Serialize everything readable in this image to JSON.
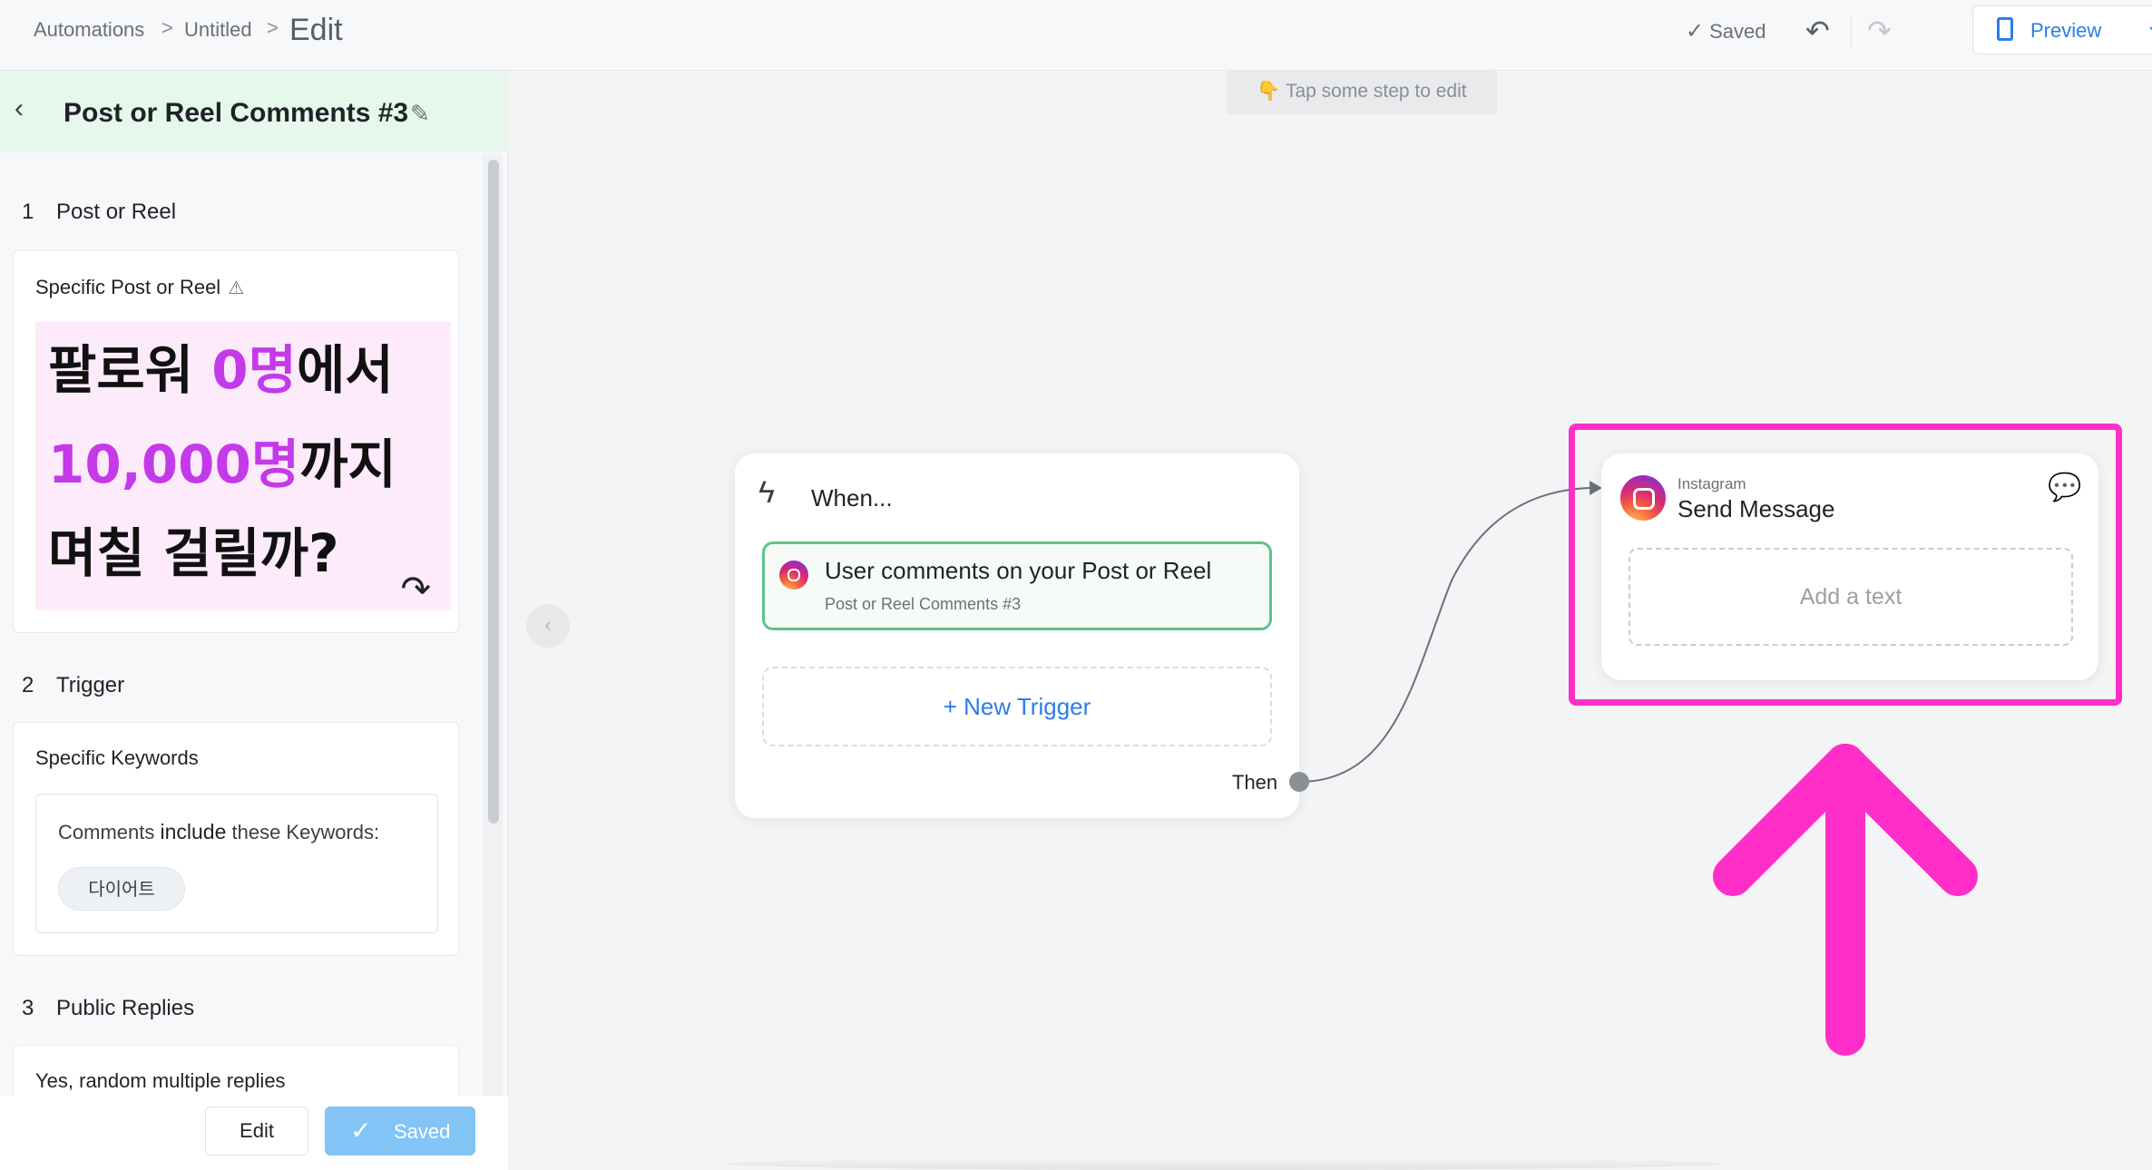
{
  "breadcrumb": {
    "root": "Automations",
    "middle": "Untitled",
    "current": "Edit",
    "sep": ">"
  },
  "topbar": {
    "saved": "Saved",
    "preview": "Preview",
    "check_glyph": "✓",
    "undo_glyph": "↶",
    "redo_glyph": "↷",
    "chevron_glyph": "⌄"
  },
  "panel": {
    "title": "Post or Reel Comments #3",
    "sections": [
      {
        "num": "1",
        "label": "Post or Reel"
      },
      {
        "num": "2",
        "label": "Trigger"
      },
      {
        "num": "3",
        "label": "Public Replies"
      }
    ],
    "post_card": {
      "title": "Specific Post or Reel",
      "thumbnail_lines": [
        {
          "a": "팔로워 ",
          "b": "0명",
          "c": "에서"
        },
        {
          "a": "",
          "b": "10,000명",
          "c": "까지"
        },
        {
          "a": "며칠 걸릴까?",
          "b": "",
          "c": ""
        }
      ]
    },
    "trigger_card": {
      "title": "Specific Keywords",
      "rule_prefix": "Comments",
      "rule_keyword": "include",
      "rule_suffix": "these Keywords:",
      "keywords": [
        "다이어트"
      ]
    },
    "replies_card": {
      "title": "Yes, random multiple replies"
    },
    "footer": {
      "edit": "Edit",
      "saved": "Saved"
    }
  },
  "canvas": {
    "hint": "👇 Tap some step to edit",
    "when_card": {
      "label": "When...",
      "trigger_title": "User comments on your Post or Reel",
      "trigger_sub": "Post or Reel Comments #3",
      "new_trigger": "+ New Trigger",
      "then": "Then"
    },
    "message_card": {
      "platform": "Instagram",
      "title": "Send Message",
      "placeholder": "Add a text"
    }
  },
  "colors": {
    "accent": "#2b7de9",
    "highlight": "#ff2ec9",
    "success": "#5cc489",
    "kpink": "#c43ae8"
  }
}
